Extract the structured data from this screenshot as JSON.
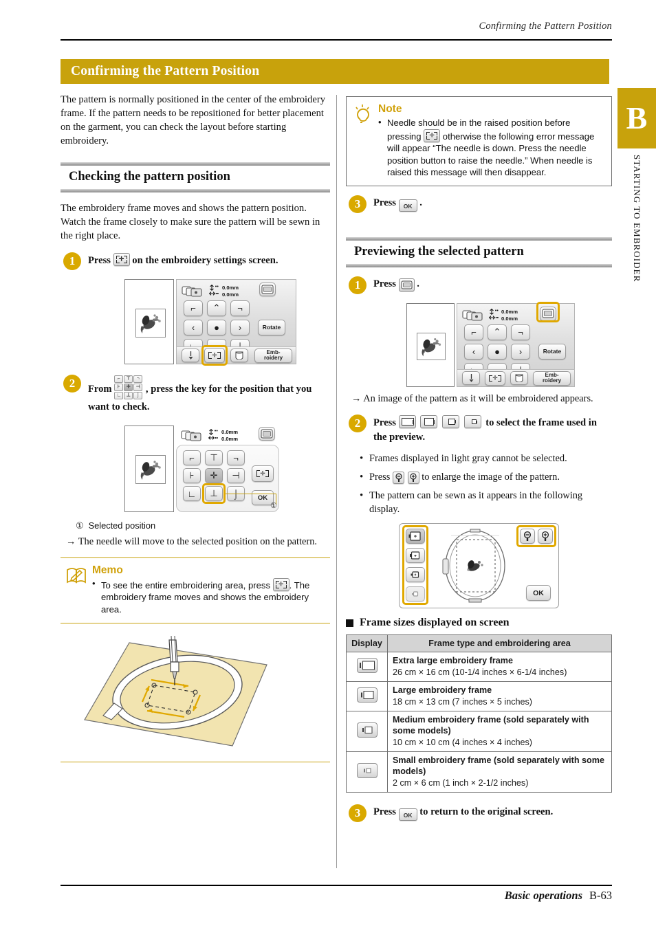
{
  "running_header": "Confirming the Pattern Position",
  "thumb_tab": {
    "letter": "B",
    "label": "STARTING TO EMBROIDER"
  },
  "title_bar": {
    "title": "Confirming the Pattern Position"
  },
  "intro": "The pattern is normally positioned in the center of the embroidery frame. If the pattern needs to be repositioned for better placement on the garment, you can check the layout before starting embroidery.",
  "section_checking": {
    "heading": "Checking the pattern position",
    "intro": "The embroidery frame moves and shows the pattern position. Watch the frame closely to make sure the pattern will be sewn in the right place.",
    "step1": {
      "num": "1",
      "pre": "Press",
      "post": "on the embroidery settings screen."
    },
    "step2": {
      "num": "2",
      "pre": "From",
      "post": ", press the key for the position that you want to check."
    },
    "callout_number": "①",
    "callout_label": "Selected position",
    "arrow_result": "→ The needle will move to the selected position on the pattern."
  },
  "memo": {
    "title": "Memo",
    "bullet_pre": "To see the entire embroidering area, press",
    "bullet_post": ". The embroidery frame moves and shows the embroidery area."
  },
  "note": {
    "title": "Note",
    "bullet_pre": "Needle should be in the raised position before pressing",
    "bullet_post": "otherwise the following error message will appear “The needle is down. Press the needle position button to raise the needle.” When needle is raised this message will then disappear."
  },
  "note_step3": {
    "num": "3",
    "pre": "Press",
    "post": "."
  },
  "section_preview": {
    "heading": "Previewing the selected pattern",
    "step1": {
      "num": "1",
      "pre": "Press",
      "post": "."
    },
    "arrow_result": "→ An image of the pattern as it will be embroidered appears.",
    "step2": {
      "num": "2",
      "pre": "Press",
      "post": "to select the frame used in the preview."
    },
    "bullets": [
      {
        "text": "Frames displayed in light gray cannot be selected."
      },
      {
        "pre": "Press",
        "post": "to enlarge the image of the pattern."
      },
      {
        "text": "The pattern can be sewn as it appears in the following display."
      }
    ],
    "step3": {
      "num": "3",
      "pre": "Press",
      "post": "to return to the original screen."
    }
  },
  "frame_table": {
    "heading": "Frame sizes displayed on screen",
    "columns": [
      "Display",
      "Frame type and embroidering area"
    ],
    "rows": [
      {
        "icon": "extra-large-frame-icon",
        "title": "Extra large embroidery frame",
        "size": "26 cm × 16 cm (10-1/4 inches × 6-1/4 inches)"
      },
      {
        "icon": "large-frame-icon",
        "title": "Large embroidery frame",
        "size": "18 cm × 13 cm (7 inches × 5 inches)"
      },
      {
        "icon": "medium-frame-icon",
        "title": "Medium embroidery frame (sold separately with some models)",
        "size": "10 cm × 10 cm (4 inches × 4 inches)"
      },
      {
        "icon": "small-frame-icon",
        "title": "Small embroidery frame (sold separately with some models)",
        "size": "2 cm × 6 cm (1 inch × 2-1/2 inches)"
      }
    ]
  },
  "lcd_settings_screen": {
    "offset_v": "0.0mm",
    "offset_h": "0.0mm",
    "rotate_label": "Rotate",
    "embroidery_label": "Emb-\nroidery",
    "embroidery_label_l1": "Emb-",
    "embroidery_label_l2": "roidery"
  },
  "lcd_position_screen": {
    "offset_v": "0.0mm",
    "offset_h": "0.0mm",
    "ok_label": "OK",
    "callout_number": "①"
  },
  "lcd_preview_screen": {
    "ok_label": "OK"
  },
  "footer": {
    "left": "Basic operations",
    "right": "B-63"
  },
  "colors": {
    "gold": "#c8a20c",
    "step_circle": "#d9a900",
    "highlight": "#e0a800",
    "rule": "#000000",
    "table_header_bg": "#d4d4d4"
  }
}
